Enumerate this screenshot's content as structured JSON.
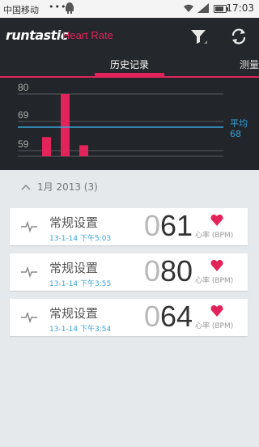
{
  "status_bar": {
    "carrier": "中国移动",
    "dots": "•••",
    "time": "17:03"
  },
  "app_bar": {
    "logo": "runtastic",
    "title": "Heart Rate",
    "brand_color": "#e3245a"
  },
  "tabs": [
    {
      "label": "历史记录",
      "selected": true
    },
    {
      "label": "测量",
      "selected": false
    }
  ],
  "chart_data": {
    "type": "bar",
    "y_ticks": [
      "80",
      "69",
      "59"
    ],
    "values": [
      64,
      80,
      61
    ],
    "average": {
      "label": "平均",
      "value": "68"
    },
    "ylim": [
      55,
      82
    ],
    "bar_color": "#e3245a",
    "average_line_color": "#3ba3d8",
    "grid": true
  },
  "section": {
    "label": "1月 2013 (3)"
  },
  "measurements": [
    {
      "name": "常规设置",
      "date": "13-1-14 下午5:03",
      "hr_zero": "0",
      "hr_value": "61",
      "unit": "心率 (BPM)"
    },
    {
      "name": "常规设置",
      "date": "13-1-14 下午3:55",
      "hr_zero": "0",
      "hr_value": "80",
      "unit": "心率 (BPM)"
    },
    {
      "name": "常规设置",
      "date": "13-1-14 下午3:54",
      "hr_zero": "0",
      "hr_value": "64",
      "unit": "心率 (BPM)"
    }
  ]
}
